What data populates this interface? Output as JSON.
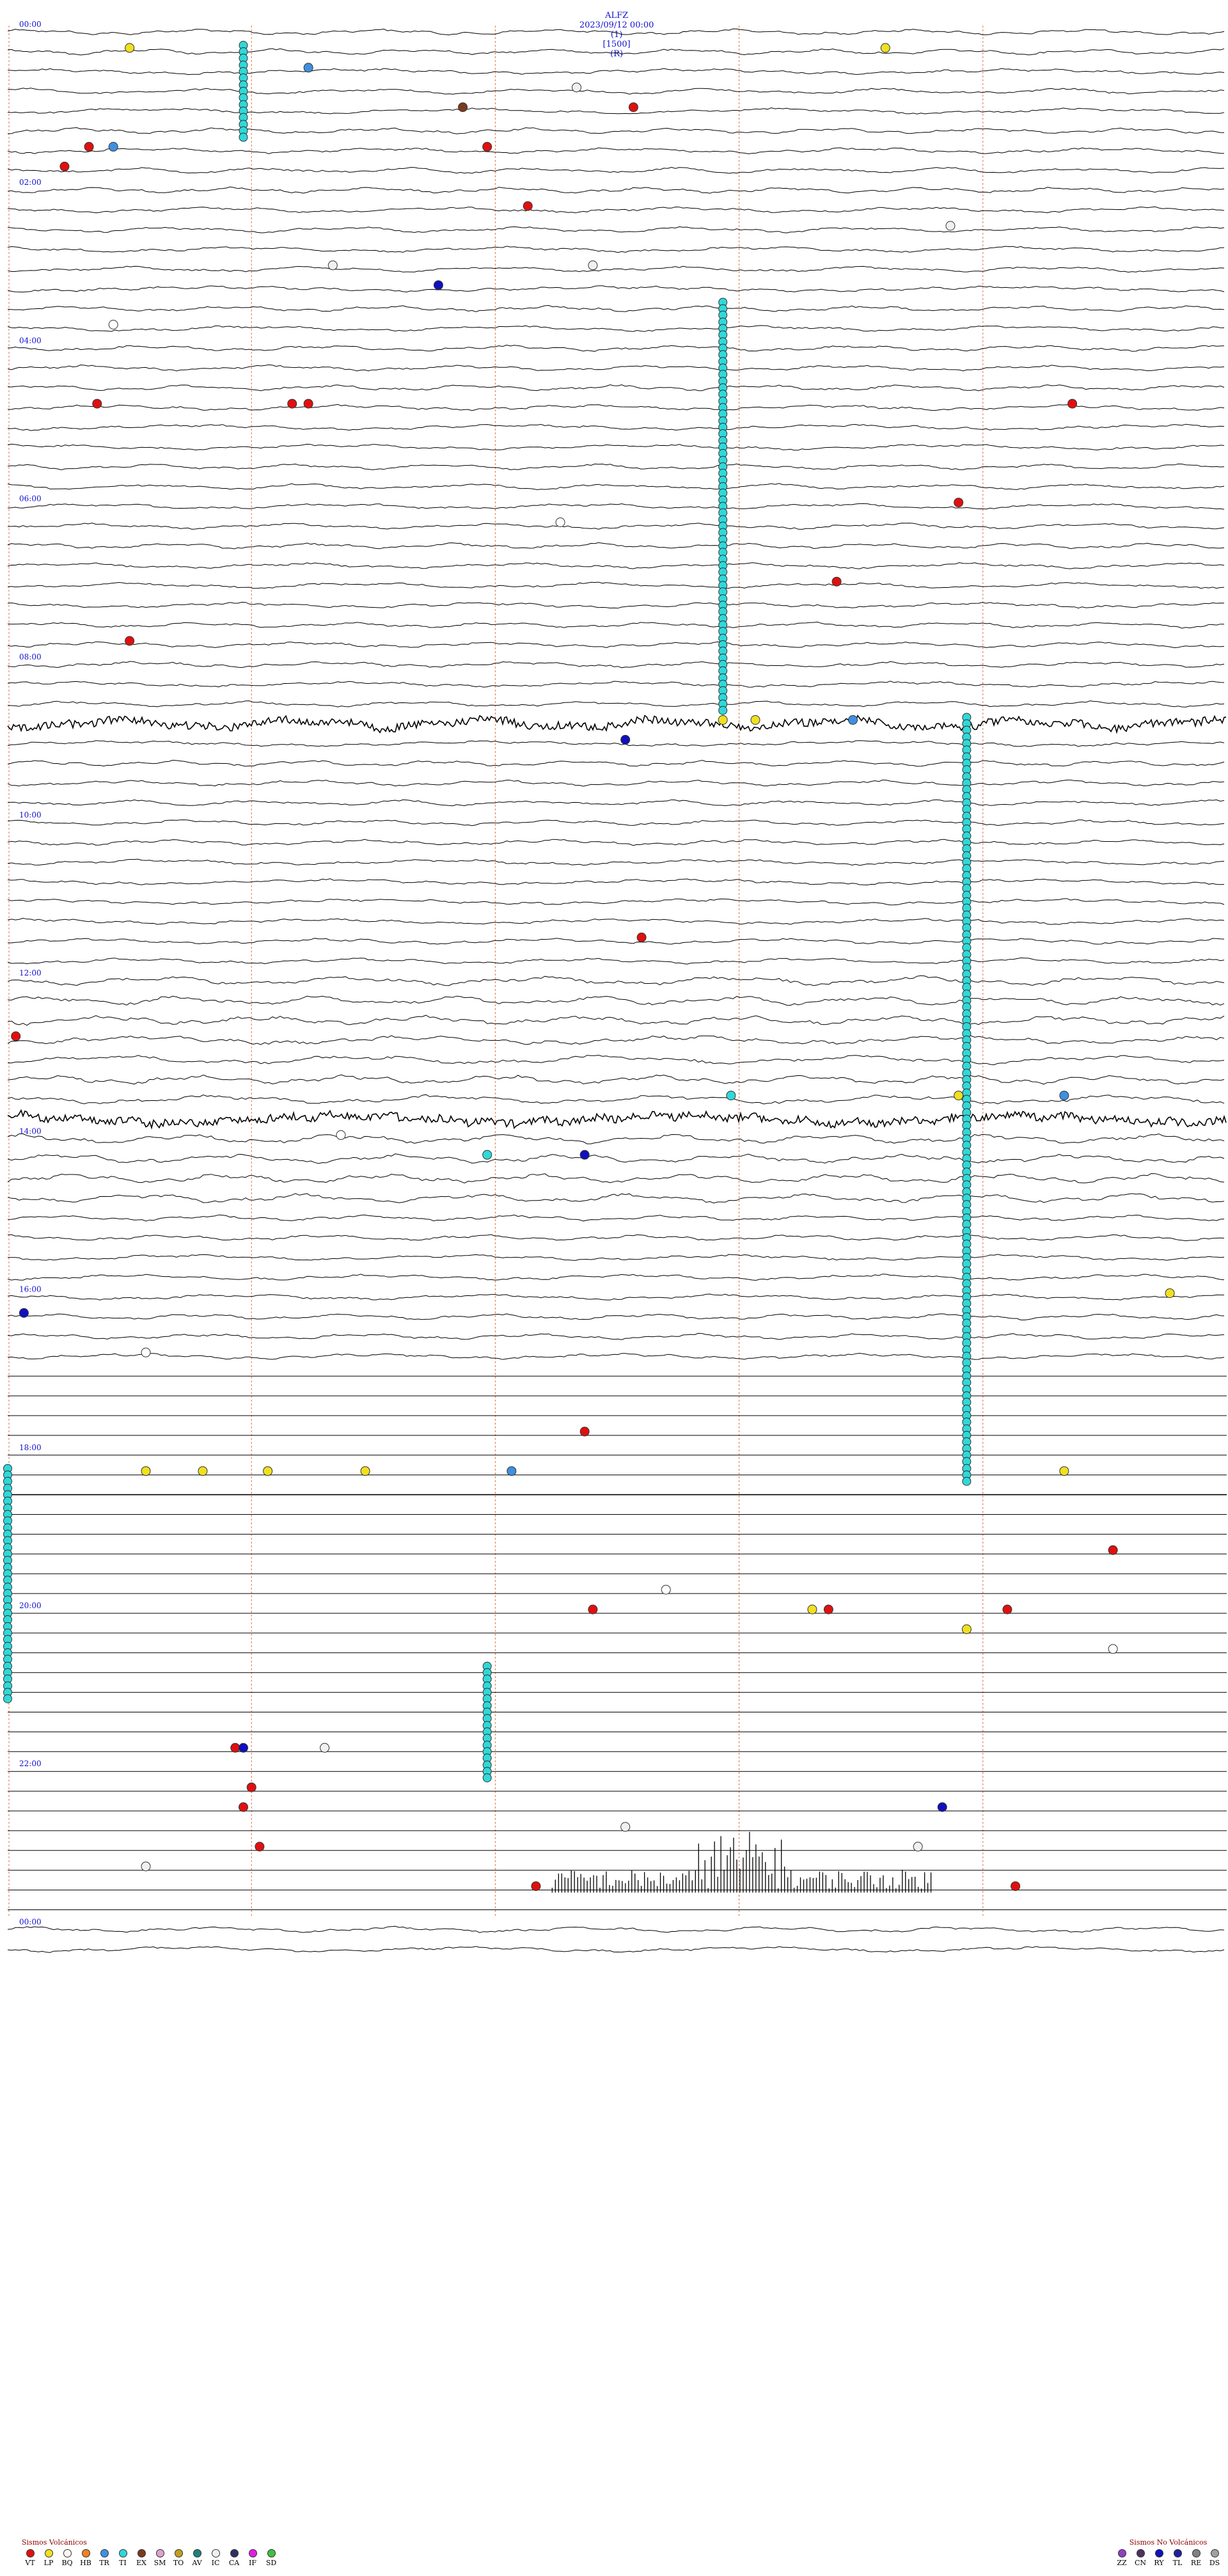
{
  "header": {
    "station": "ALFZ",
    "datetime": "2023/09/12 00:00",
    "channel": "(1)",
    "scale": "[1500]",
    "mode": "(R)"
  },
  "chart_data": {
    "type": "seismogram",
    "rows": 96,
    "minutes_per_row": 15,
    "hour_labels": [
      "00:00",
      "02:00",
      "04:00",
      "06:00",
      "08:00",
      "10:00",
      "12:00",
      "14:00",
      "16:00",
      "18:00",
      "20:00",
      "22:00",
      "00:00"
    ],
    "flatline_from_row": 68,
    "flatline_to_row": 96,
    "noisy_rows": [
      35,
      55,
      74
    ],
    "events": [
      {
        "row": 1,
        "minute": 1.5,
        "type": "LP"
      },
      {
        "row": 1,
        "minute": 10.8,
        "type": "LP"
      },
      {
        "row": 2,
        "minute": 3.7,
        "type": "TR"
      },
      {
        "row": 3,
        "minute": 7.0,
        "type": "IC"
      },
      {
        "row": 4,
        "minute": 7.7,
        "type": "VT"
      },
      {
        "row": 4,
        "minute": 5.6,
        "type": "EX"
      },
      {
        "row": 6,
        "minute": 1.0,
        "type": "VT"
      },
      {
        "row": 6,
        "minute": 1.3,
        "type": "TR"
      },
      {
        "row": 6,
        "minute": 5.9,
        "type": "VT"
      },
      {
        "row": 7,
        "minute": 0.7,
        "type": "VT"
      },
      {
        "row": 9,
        "minute": 6.4,
        "type": "VT"
      },
      {
        "row": 10,
        "minute": 11.6,
        "type": "IC"
      },
      {
        "row": 12,
        "minute": 4.0,
        "type": "IC"
      },
      {
        "row": 12,
        "minute": 7.2,
        "type": "IC"
      },
      {
        "row": 13,
        "minute": 5.3,
        "type": "RY"
      },
      {
        "row": 15,
        "minute": 1.3,
        "type": "BE"
      },
      {
        "row": 19,
        "minute": 13.1,
        "type": "VT"
      },
      {
        "row": 19,
        "minute": 1.1,
        "type": "VT"
      },
      {
        "row": 19,
        "minute": 3.5,
        "type": "VT"
      },
      {
        "row": 19,
        "minute": 3.7,
        "type": "VT"
      },
      {
        "row": 24,
        "minute": 11.7,
        "type": "VT"
      },
      {
        "row": 25,
        "minute": 6.8,
        "type": "BE"
      },
      {
        "row": 28,
        "minute": 10.2,
        "type": "VT"
      },
      {
        "row": 31,
        "minute": 1.5,
        "type": "VT"
      },
      {
        "row": 35,
        "minute": 8.8,
        "type": "LP"
      },
      {
        "row": 35,
        "minute": 9.2,
        "type": "LP"
      },
      {
        "row": 35,
        "minute": 10.4,
        "type": "TR"
      },
      {
        "row": 36,
        "minute": 7.6,
        "type": "RY"
      },
      {
        "row": 46,
        "minute": 7.8,
        "type": "VT"
      },
      {
        "row": 51,
        "minute": 0.1,
        "type": "VT"
      },
      {
        "row": 54,
        "minute": 8.9,
        "type": "TI"
      },
      {
        "row": 54,
        "minute": 11.7,
        "type": "LP"
      },
      {
        "row": 54,
        "minute": 13.0,
        "type": "TR"
      },
      {
        "row": 56,
        "minute": 4.1,
        "type": "BE"
      },
      {
        "row": 57,
        "minute": 7.1,
        "type": "RY"
      },
      {
        "row": 57,
        "minute": 5.9,
        "type": "TI"
      },
      {
        "row": 64,
        "minute": 14.3,
        "type": "LP"
      },
      {
        "row": 65,
        "minute": 0.2,
        "type": "RY"
      },
      {
        "row": 67,
        "minute": 1.7,
        "type": "BE"
      },
      {
        "row": 71,
        "minute": 7.1,
        "type": "VT"
      },
      {
        "row": 73,
        "minute": 1.7,
        "type": "LP"
      },
      {
        "row": 73,
        "minute": 2.4,
        "type": "LP"
      },
      {
        "row": 73,
        "minute": 3.2,
        "type": "LP"
      },
      {
        "row": 73,
        "minute": 4.4,
        "type": "LP"
      },
      {
        "row": 73,
        "minute": 6.2,
        "type": "TR"
      },
      {
        "row": 73,
        "minute": 13.0,
        "type": "LP"
      },
      {
        "row": 77,
        "minute": 13.6,
        "type": "VT"
      },
      {
        "row": 79,
        "minute": 8.1,
        "type": "BE"
      },
      {
        "row": 80,
        "minute": 7.2,
        "type": "VT"
      },
      {
        "row": 80,
        "minute": 9.9,
        "type": "LP"
      },
      {
        "row": 80,
        "minute": 10.1,
        "type": "VT"
      },
      {
        "row": 80,
        "minute": 12.3,
        "type": "VT"
      },
      {
        "row": 81,
        "minute": 11.8,
        "type": "LP"
      },
      {
        "row": 82,
        "minute": 13.6,
        "type": "BE"
      },
      {
        "row": 87,
        "minute": 2.8,
        "type": "VT"
      },
      {
        "row": 87,
        "minute": 2.9,
        "type": "RY"
      },
      {
        "row": 87,
        "minute": 3.9,
        "type": "IC"
      },
      {
        "row": 89,
        "minute": 3.0,
        "type": "VT"
      },
      {
        "row": 90,
        "minute": 2.9,
        "type": "VT"
      },
      {
        "row": 90,
        "minute": 11.5,
        "type": "RY"
      },
      {
        "row": 91,
        "minute": 7.6,
        "type": "IC"
      },
      {
        "row": 92,
        "minute": 11.2,
        "type": "IC"
      },
      {
        "row": 92,
        "minute": 3.1,
        "type": "VT"
      },
      {
        "row": 93,
        "minute": 1.7,
        "type": "IC"
      },
      {
        "row": 94,
        "minute": 12.4,
        "type": "VT"
      },
      {
        "row": 94,
        "minute": 6.5,
        "type": "VT"
      }
    ],
    "event_columns": [
      {
        "minute": 2.9,
        "row_from": 1,
        "row_to": 5,
        "type": "TI"
      },
      {
        "minute": 8.8,
        "row_from": 14,
        "row_to": 34,
        "type": "TI"
      },
      {
        "minute": 11.8,
        "row_from": 35,
        "row_to": 73,
        "type": "TI"
      },
      {
        "minute": 0.0,
        "row_from": 73,
        "row_to": 84,
        "type": "TI"
      },
      {
        "minute": 5.9,
        "row_from": 83,
        "row_to": 88,
        "type": "TI"
      }
    ]
  },
  "legend": {
    "volcanic_title": "Sismos Volcánicos",
    "volcanic": [
      {
        "code": "VT",
        "color": "#e01010"
      },
      {
        "code": "LP",
        "color": "#f0e020"
      },
      {
        "code": "BQ",
        "color": "#f8f8f0"
      },
      {
        "code": "HB",
        "color": "#f08020"
      },
      {
        "code": "TR",
        "color": "#4090e0"
      },
      {
        "code": "TI",
        "color": "#30d8d8"
      },
      {
        "code": "EX",
        "color": "#7a3a20"
      },
      {
        "code": "SM",
        "color": "#e0a0d0"
      },
      {
        "code": "TO",
        "color": "#c0a020"
      },
      {
        "code": "AV",
        "color": "#208080"
      },
      {
        "code": "IC",
        "color": "#f0f0f0"
      },
      {
        "code": "CA",
        "color": "#303060"
      },
      {
        "code": "IF",
        "color": "#e020e0"
      },
      {
        "code": "SD",
        "color": "#40c040"
      }
    ],
    "non_volcanic_title": "Sismos No Volcánicos",
    "non_volcanic": [
      {
        "code": "ZZ",
        "color": "#9040c0"
      },
      {
        "code": "CN",
        "color": "#503060"
      },
      {
        "code": "RY",
        "color": "#1010c0"
      },
      {
        "code": "TL",
        "color": "#2020a0"
      },
      {
        "code": "RE",
        "color": "#808080"
      },
      {
        "code": "DS",
        "color": "#a0a0a0"
      }
    ]
  }
}
